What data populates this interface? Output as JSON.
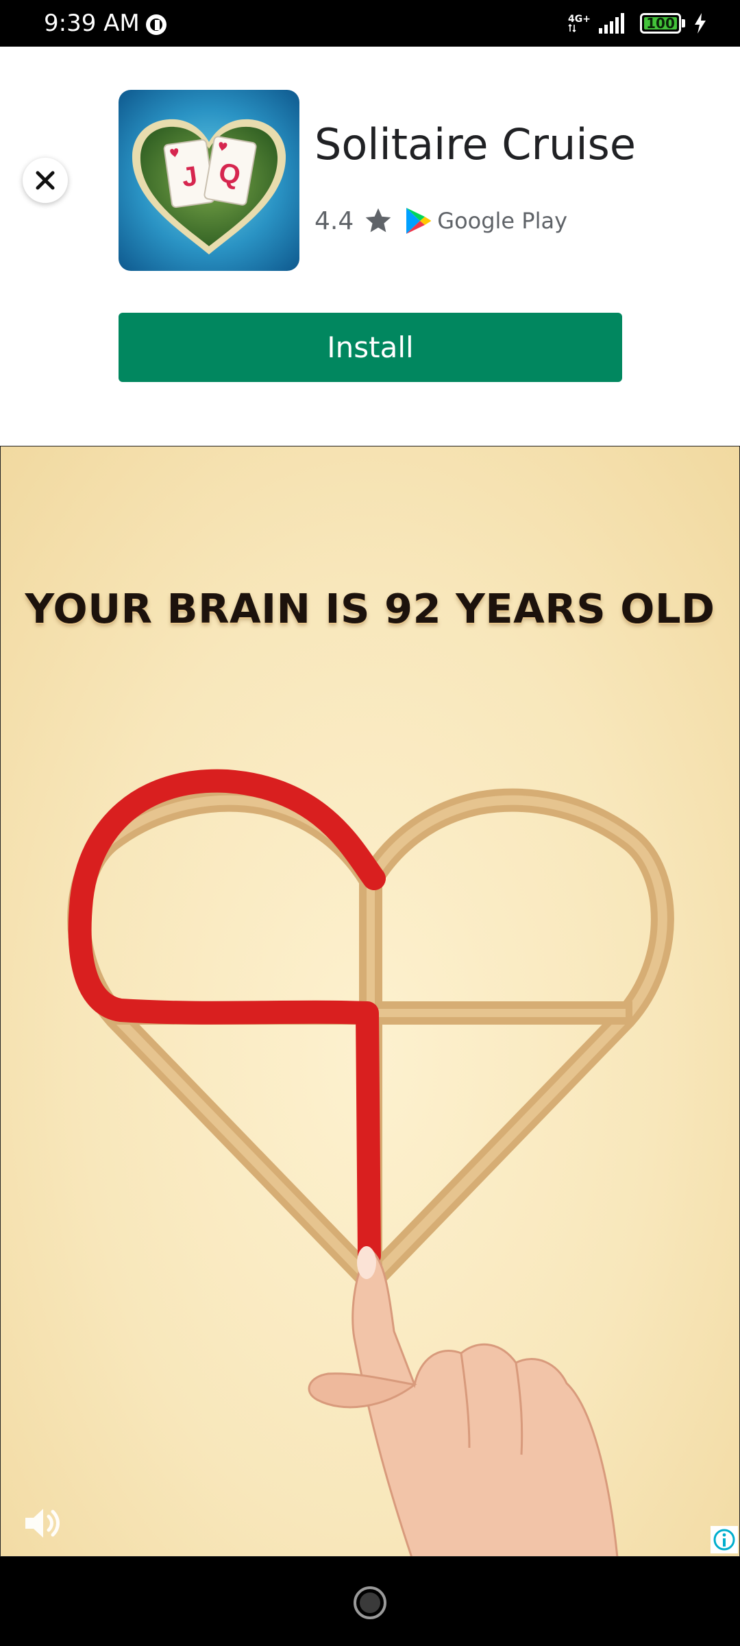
{
  "status_bar": {
    "time": "9:39 AM",
    "network": "4G+",
    "battery_level": "100",
    "battery_fraction": 1.0
  },
  "ad": {
    "app_name": "Solitaire Cruise",
    "rating": "4.4",
    "store": "Google Play",
    "install_label": "Install",
    "icon_cards": [
      "J",
      "Q"
    ],
    "accent_color": "#01875f"
  },
  "creative": {
    "headline": "YOUR BRAIN IS 92 YEARS OLD"
  },
  "icons": {
    "close": "close-icon",
    "star": "star-icon",
    "store_logo": "google-play-icon",
    "sound": "volume-icon",
    "info": "info-icon",
    "home": "home-icon"
  }
}
